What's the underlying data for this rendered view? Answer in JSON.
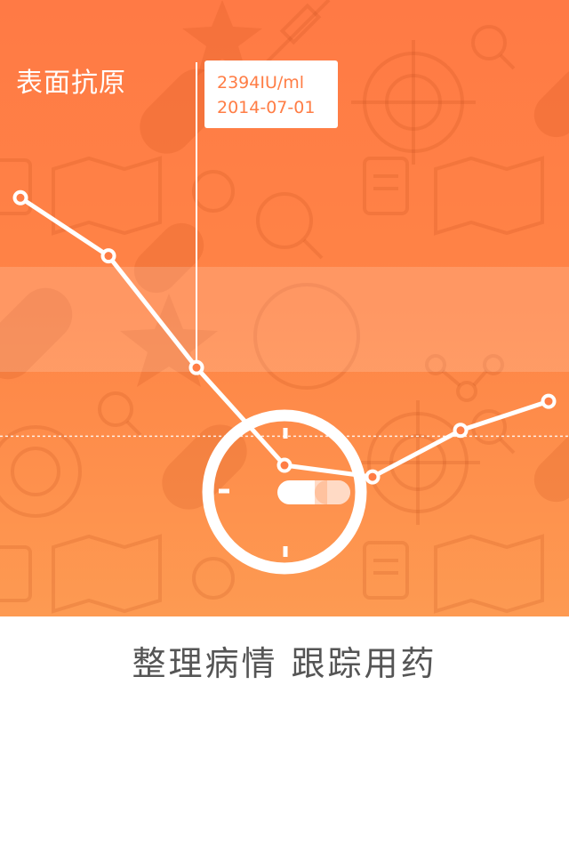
{
  "hero": {
    "title": "表面抗原",
    "background_top": "#ff7a45",
    "background_bottom": "#fd9a52"
  },
  "chart_data": {
    "type": "line",
    "title": "表面抗原",
    "x": [
      1,
      2,
      3,
      4,
      5,
      6,
      7
    ],
    "values": [
      2540,
      2490,
      2394,
      2310,
      2300,
      2340,
      2365
    ],
    "ylim": [
      2180,
      2710
    ],
    "reference_line": 2335,
    "selected_index": 2,
    "tooltip": {
      "value": "2394IU/ml",
      "date": "2014-07-01"
    },
    "color": "#ffffff",
    "grid": false
  },
  "clock_icon": "clock-with-pill-icon",
  "decorative_icons": [
    "pill-icon",
    "dictionary-icon",
    "map-icon",
    "magnifier-icon",
    "compass-icon",
    "medal-icon",
    "syringe-icon",
    "molecule-icon"
  ],
  "caption": "整理病情 跟踪用药"
}
